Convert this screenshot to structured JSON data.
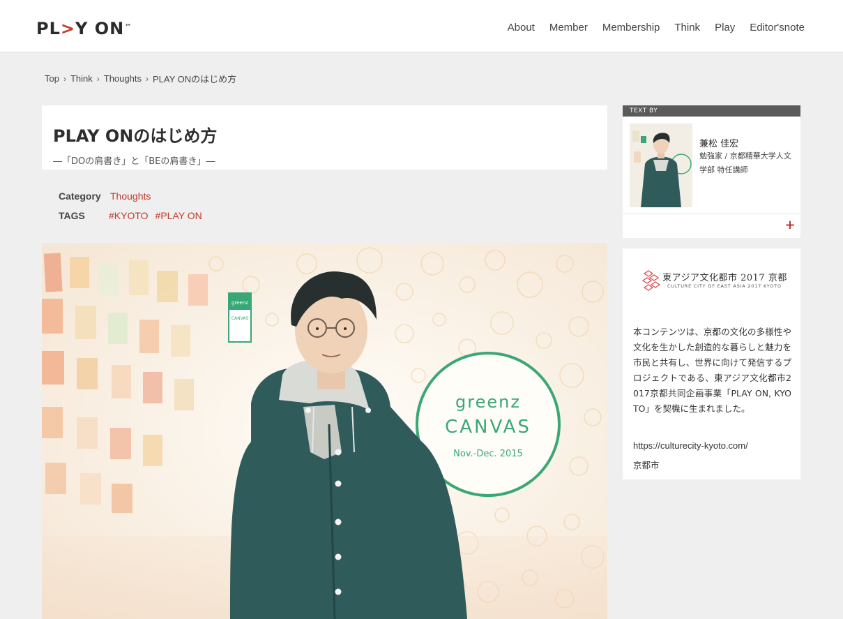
{
  "header": {
    "logo": {
      "pre": "PL",
      "arrow": ">",
      "post": "Y ON",
      "tm": "™"
    },
    "nav": [
      "About",
      "Member",
      "Membership",
      "Think",
      "Play",
      "Editor'snote"
    ]
  },
  "breadcrumb": {
    "items": [
      "Top",
      "Think",
      "Thoughts",
      "PLAY ONのはじめ方"
    ],
    "separator": "›"
  },
  "article": {
    "title": "PLAY ONのはじめ方",
    "subtitle": "―「DOの肩書き」と「BEの肩書き」―",
    "category_label": "Category",
    "category": "Thoughts",
    "tags_label": "TAGS",
    "tags": [
      "#KYOTO",
      "#PLAY ON"
    ]
  },
  "hero": {
    "sign_line1": "greenz",
    "sign_line2": "CANVAS",
    "sign_line3": "Nov.-Dec. 2015",
    "flag_text1": "greenz",
    "flag_text2": "CANVAS"
  },
  "author": {
    "bar_label": "TEXT BY",
    "name": "兼松 佳宏",
    "role": "勉強家 / 京都精華大学人文学部 特任講師",
    "expand_icon": "+"
  },
  "info": {
    "logo_title": "東アジア文化都市 2017 京都",
    "logo_sub": "CULTURE CITY OF EAST ASIA 2017 KYOTO",
    "text": "本コンテンツは、京都の文化の多様性や文化を生かした創造的な暮らしと魅力を市民と共有し、世界に向けて発信するプロジェクトである、東アジア文化都市2017京都共同企画事業「PLAY ON, KYOTO」を契機に生まれました。",
    "url": "https://culturecity-kyoto.com/",
    "org": "京都市"
  },
  "colors": {
    "accent": "#c0392b",
    "background": "#efefef",
    "author_bar": "#5a5a5a",
    "sign_green": "#3aa776"
  }
}
